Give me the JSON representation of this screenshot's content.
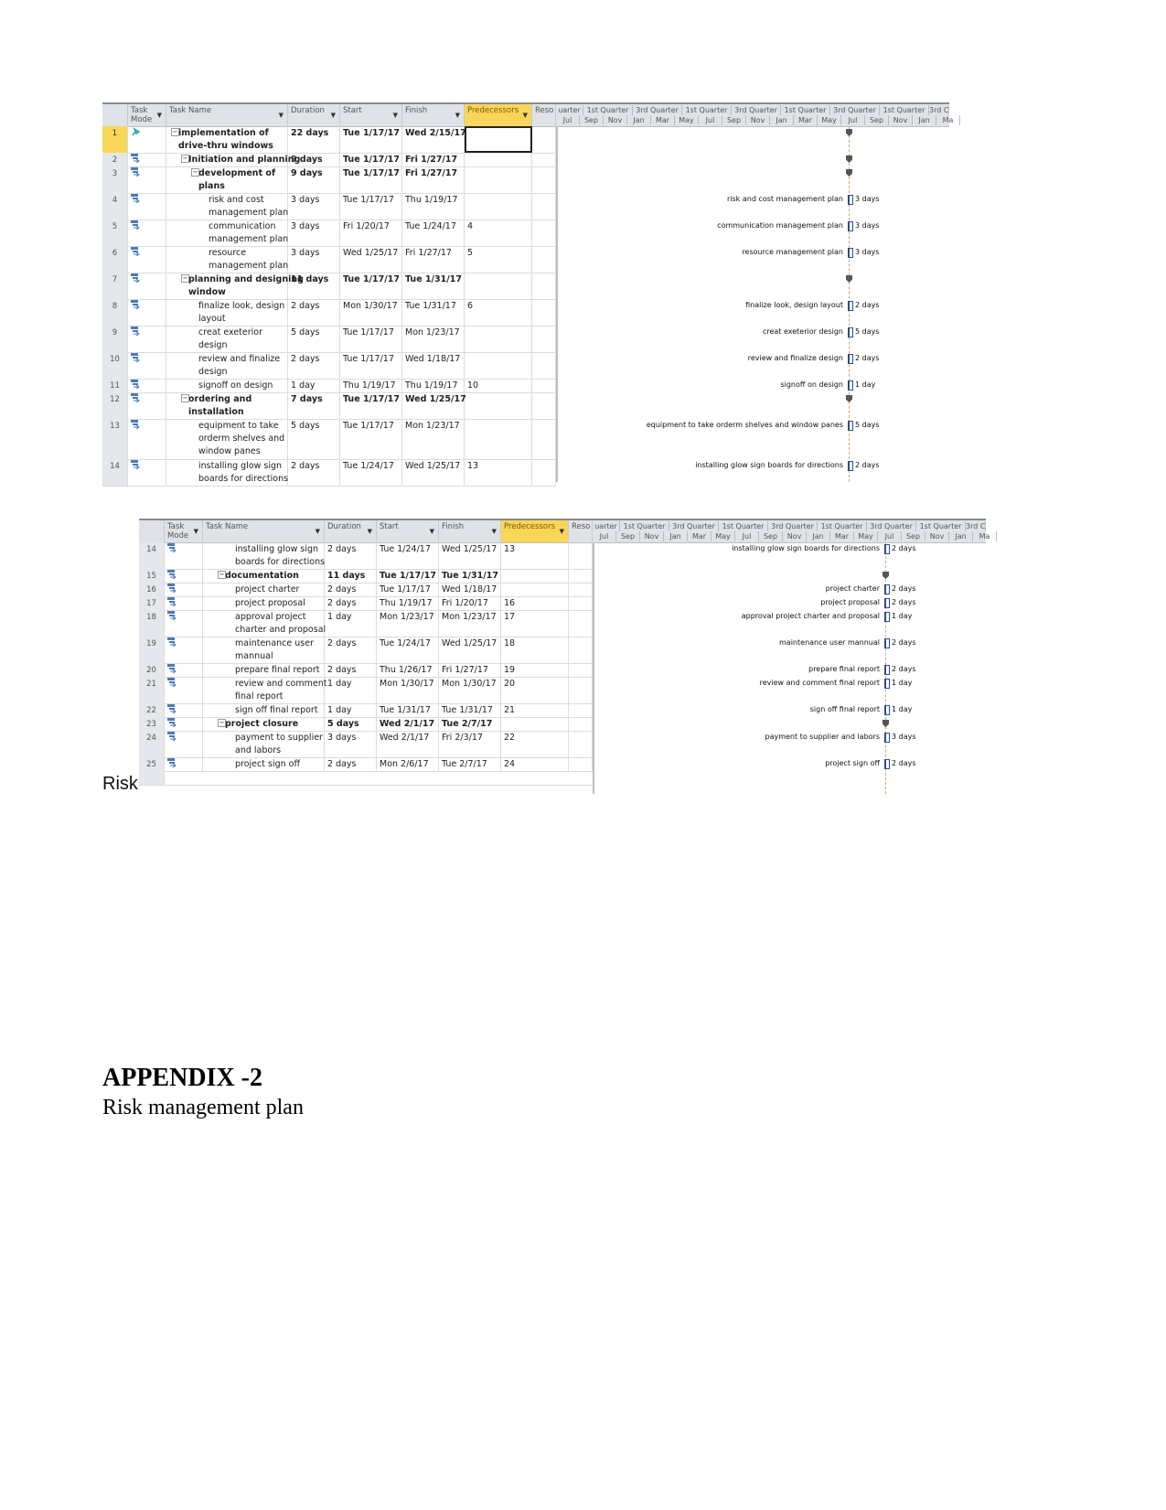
{
  "colors": {
    "header_bg": "#dfe3e8",
    "predecessors_header": "#f9d65a",
    "selected_row": "#f9d65a",
    "task_mode_icon": "#4a7ab8",
    "today_line": "#e8a070"
  },
  "columns": {
    "task_mode": "Task Mode",
    "task_name": "Task Name",
    "duration": "Duration",
    "start": "Start",
    "finish": "Finish",
    "predecessors": "Predecessors",
    "resources": "Reso"
  },
  "timescale": {
    "quarters": [
      "uarter",
      "1st Quarter",
      "3rd Quarter",
      "1st Quarter",
      "3rd Quarter",
      "1st Quarter",
      "3rd Quarter",
      "1st Quarter",
      "3rd C"
    ],
    "months": [
      "Jul",
      "Sep",
      "Nov",
      "Jan",
      "Mar",
      "May",
      "Jul",
      "Sep",
      "Nov",
      "Jan",
      "Mar",
      "May",
      "Jul",
      "Sep",
      "Nov",
      "Jan",
      "Ma"
    ]
  },
  "table1": {
    "rows": [
      {
        "id": "1",
        "mode": "manual-pin-icon",
        "level": 0,
        "summary": true,
        "selected": true,
        "name": [
          "implementation of",
          "drive-thru windows"
        ],
        "duration": "22 days",
        "start": "Tue 1/17/17",
        "finish": "Wed 2/15/17",
        "pred": "",
        "gantt_label": "",
        "gantt_duration": ""
      },
      {
        "id": "2",
        "mode": "auto-schedule-icon",
        "level": 1,
        "summary": true,
        "name": [
          "Initiation and planning"
        ],
        "duration": "9 days",
        "start": "Tue 1/17/17",
        "finish": "Fri 1/27/17",
        "pred": "",
        "gantt_label": "",
        "gantt_duration": ""
      },
      {
        "id": "3",
        "mode": "auto-schedule-icon",
        "level": 2,
        "summary": true,
        "name": [
          "development of",
          "plans"
        ],
        "duration": "9 days",
        "start": "Tue 1/17/17",
        "finish": "Fri 1/27/17",
        "pred": "",
        "gantt_label": "",
        "gantt_duration": ""
      },
      {
        "id": "4",
        "mode": "auto-schedule-icon",
        "level": 3,
        "name": [
          "risk and cost",
          "management plan"
        ],
        "duration": "3 days",
        "start": "Tue 1/17/17",
        "finish": "Thu 1/19/17",
        "pred": "",
        "gantt_label": "risk and cost management plan",
        "gantt_duration": "3 days"
      },
      {
        "id": "5",
        "mode": "auto-schedule-icon",
        "level": 3,
        "name": [
          "communication",
          "management plan"
        ],
        "duration": "3 days",
        "start": "Fri 1/20/17",
        "finish": "Tue 1/24/17",
        "pred": "4",
        "gantt_label": "communication management plan",
        "gantt_duration": "3 days"
      },
      {
        "id": "6",
        "mode": "auto-schedule-icon",
        "level": 3,
        "name": [
          "resource",
          "management plan"
        ],
        "duration": "3 days",
        "start": "Wed 1/25/17",
        "finish": "Fri 1/27/17",
        "pred": "5",
        "gantt_label": "resource management plan",
        "gantt_duration": "3 days"
      },
      {
        "id": "7",
        "mode": "auto-schedule-icon",
        "level": 1,
        "summary": true,
        "name": [
          "planning and designing",
          "window"
        ],
        "duration": "11 days",
        "start": "Tue 1/17/17",
        "finish": "Tue 1/31/17",
        "pred": "",
        "gantt_label": "",
        "gantt_duration": ""
      },
      {
        "id": "8",
        "mode": "auto-schedule-icon",
        "level": 2,
        "name": [
          "finalize look, design",
          "layout"
        ],
        "duration": "2 days",
        "start": "Mon 1/30/17",
        "finish": "Tue 1/31/17",
        "pred": "6",
        "gantt_label": "finalize look, design layout",
        "gantt_duration": "2 days"
      },
      {
        "id": "9",
        "mode": "auto-schedule-icon",
        "level": 2,
        "name": [
          "creat exeterior",
          "design"
        ],
        "duration": "5 days",
        "start": "Tue 1/17/17",
        "finish": "Mon 1/23/17",
        "pred": "",
        "gantt_label": "creat exeterior design",
        "gantt_duration": "5 days"
      },
      {
        "id": "10",
        "mode": "auto-schedule-icon",
        "level": 2,
        "name": [
          "review and finalize",
          "design"
        ],
        "duration": "2 days",
        "start": "Tue 1/17/17",
        "finish": "Wed 1/18/17",
        "pred": "",
        "gantt_label": "review and finalize design",
        "gantt_duration": "2 days"
      },
      {
        "id": "11",
        "mode": "auto-schedule-icon",
        "level": 2,
        "name": [
          "signoff on design"
        ],
        "duration": "1 day",
        "start": "Thu 1/19/17",
        "finish": "Thu 1/19/17",
        "pred": "10",
        "gantt_label": "signoff on design",
        "gantt_duration": "1 day"
      },
      {
        "id": "12",
        "mode": "auto-schedule-icon",
        "level": 1,
        "summary": true,
        "name": [
          "ordering and",
          "installation"
        ],
        "duration": "7 days",
        "start": "Tue 1/17/17",
        "finish": "Wed 1/25/17",
        "pred": "",
        "gantt_label": "",
        "gantt_duration": ""
      },
      {
        "id": "13",
        "mode": "auto-schedule-icon",
        "level": 2,
        "name": [
          "equipment to take",
          "orderm shelves and",
          "window panes"
        ],
        "duration": "5 days",
        "start": "Tue 1/17/17",
        "finish": "Mon 1/23/17",
        "pred": "",
        "gantt_label": "equipment to take orderm shelves and window panes",
        "gantt_duration": "5 days"
      },
      {
        "id": "14",
        "mode": "auto-schedule-icon",
        "level": 2,
        "name": [
          "installing glow sign",
          "boards for directions"
        ],
        "duration": "2 days",
        "start": "Tue 1/24/17",
        "finish": "Wed 1/25/17",
        "pred": "13",
        "gantt_label": "installing glow sign boards for directions",
        "gantt_duration": "2 days"
      }
    ]
  },
  "table2": {
    "rows": [
      {
        "id": "14",
        "mode": "auto-schedule-icon",
        "level": 2,
        "name": [
          "installing glow sign",
          "boards for directions"
        ],
        "duration": "2 days",
        "start": "Tue 1/24/17",
        "finish": "Wed 1/25/17",
        "pred": "13",
        "gantt_label": "installing glow sign boards for directions",
        "gantt_duration": "2 days"
      },
      {
        "id": "15",
        "mode": "auto-schedule-icon",
        "level": 1,
        "summary": true,
        "name": [
          "documentation"
        ],
        "duration": "11 days",
        "start": "Tue 1/17/17",
        "finish": "Tue 1/31/17",
        "pred": "",
        "gantt_label": "",
        "gantt_duration": ""
      },
      {
        "id": "16",
        "mode": "auto-schedule-icon",
        "level": 2,
        "name": [
          "project charter"
        ],
        "duration": "2 days",
        "start": "Tue 1/17/17",
        "finish": "Wed 1/18/17",
        "pred": "",
        "gantt_label": "project charter",
        "gantt_duration": "2 days"
      },
      {
        "id": "17",
        "mode": "auto-schedule-icon",
        "level": 2,
        "name": [
          "project proposal"
        ],
        "duration": "2 days",
        "start": "Thu 1/19/17",
        "finish": "Fri 1/20/17",
        "pred": "16",
        "gantt_label": "project proposal",
        "gantt_duration": "2 days"
      },
      {
        "id": "18",
        "mode": "auto-schedule-icon",
        "level": 2,
        "name": [
          "approval project",
          "charter and proposal"
        ],
        "duration": "1 day",
        "start": "Mon 1/23/17",
        "finish": "Mon 1/23/17",
        "pred": "17",
        "gantt_label": "approval project charter and proposal",
        "gantt_duration": "1 day"
      },
      {
        "id": "19",
        "mode": "auto-schedule-icon",
        "level": 2,
        "name": [
          "maintenance user",
          "mannual"
        ],
        "duration": "2 days",
        "start": "Tue 1/24/17",
        "finish": "Wed 1/25/17",
        "pred": "18",
        "gantt_label": "maintenance user mannual",
        "gantt_duration": "2 days"
      },
      {
        "id": "20",
        "mode": "auto-schedule-icon",
        "level": 2,
        "name": [
          "prepare final report"
        ],
        "duration": "2 days",
        "start": "Thu 1/26/17",
        "finish": "Fri 1/27/17",
        "pred": "19",
        "gantt_label": "prepare final report",
        "gantt_duration": "2 days"
      },
      {
        "id": "21",
        "mode": "auto-schedule-icon",
        "level": 2,
        "name": [
          "review and comment",
          "final report"
        ],
        "duration": "1 day",
        "start": "Mon 1/30/17",
        "finish": "Mon 1/30/17",
        "pred": "20",
        "gantt_label": "review and comment final report",
        "gantt_duration": "1 day"
      },
      {
        "id": "22",
        "mode": "auto-schedule-icon",
        "level": 2,
        "name": [
          "sign off final report"
        ],
        "duration": "1 day",
        "start": "Tue 1/31/17",
        "finish": "Tue 1/31/17",
        "pred": "21",
        "gantt_label": "sign off final report",
        "gantt_duration": "1 day"
      },
      {
        "id": "23",
        "mode": "auto-schedule-icon",
        "level": 1,
        "summary": true,
        "name": [
          "project closure"
        ],
        "duration": "5 days",
        "start": "Wed 2/1/17",
        "finish": "Tue 2/7/17",
        "pred": "",
        "gantt_label": "",
        "gantt_duration": ""
      },
      {
        "id": "24",
        "mode": "auto-schedule-icon",
        "level": 2,
        "name": [
          "payment to supplier",
          "and labors"
        ],
        "duration": "3 days",
        "start": "Wed 2/1/17",
        "finish": "Fri 2/3/17",
        "pred": "22",
        "gantt_label": "payment to supplier and labors",
        "gantt_duration": "3 days"
      },
      {
        "id": "25",
        "mode": "auto-schedule-icon",
        "level": 2,
        "name": [
          "project sign off"
        ],
        "duration": "2 days",
        "start": "Mon 2/6/17",
        "finish": "Tue 2/7/17",
        "pred": "24",
        "gantt_label": "project sign off",
        "gantt_duration": "2 days"
      }
    ]
  },
  "doc": {
    "risk_label": "Risk",
    "appendix_title": "APPENDIX -2",
    "appendix_subtitle": "Risk management plan"
  }
}
